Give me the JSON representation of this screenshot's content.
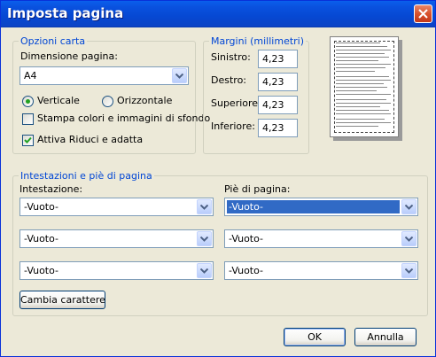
{
  "title": "Imposta pagina",
  "opzioni_carta": {
    "legend": "Opzioni carta",
    "dimensione_label": "Dimensione pagina:",
    "dimensione_value": "A4",
    "verticale": "Verticale",
    "orizzontale": "Orizzontale",
    "orientation_selected": "Verticale",
    "stampa_colori": "Stampa colori e immagini di sfondo",
    "stampa_colori_checked": false,
    "attiva_riduci": "Attiva Riduci e adatta",
    "attiva_riduci_checked": true
  },
  "margini": {
    "legend": "Margini (millimetri)",
    "sinistro_label": "Sinistro:",
    "sinistro_value": "4,23",
    "destro_label": "Destro:",
    "destro_value": "4,23",
    "superiore_label": "Superiore:",
    "superiore_value": "4,23",
    "inferiore_label": "Inferiore:",
    "inferiore_value": "4,23"
  },
  "intestazioni": {
    "legend": "Intestazioni e piè di pagina",
    "intestazione_label": "Intestazione:",
    "pie_label": "Piè di pagina:",
    "header_selects": [
      "-Vuoto-",
      "-Vuoto-",
      "-Vuoto-"
    ],
    "footer_selects": [
      "-Vuoto-",
      "-Vuoto-",
      "-Vuoto-"
    ],
    "cambia_carattere": "Cambia carattere"
  },
  "buttons": {
    "ok": "OK",
    "annulla": "Annulla"
  },
  "colors": {
    "titlebar": "#0a53e0",
    "legend": "#0046d5",
    "highlight": "#316ac5"
  }
}
